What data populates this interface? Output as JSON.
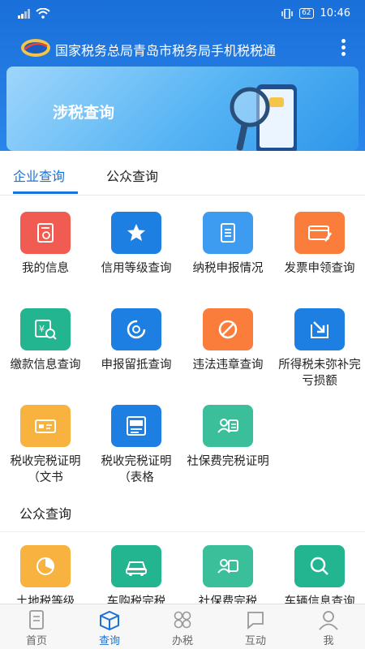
{
  "status_bar": {
    "time": "10:46",
    "battery": "62"
  },
  "app": {
    "title": "国家税务总局青岛市税务局手机税税通"
  },
  "banner": {
    "title": "涉税查询"
  },
  "tabs": [
    {
      "label": "企业查询",
      "active": true
    },
    {
      "label": "公众查询",
      "active": false
    }
  ],
  "enterprise_items": [
    {
      "label": "我的信息",
      "icon": "info-doc-icon",
      "color": "#f05b52"
    },
    {
      "label": "信用等级查询",
      "icon": "star-icon",
      "color": "#1e7fe3"
    },
    {
      "label": "纳税申报情况",
      "icon": "list-doc-icon",
      "color": "#3d9cf0"
    },
    {
      "label": "发票申领查询",
      "icon": "invoice-card-icon",
      "color": "#fa7d3c"
    },
    {
      "label": "缴款信息查询",
      "icon": "yen-search-icon",
      "color": "#22b58f"
    },
    {
      "label": "申报留抵查询",
      "icon": "refresh-circle-icon",
      "color": "#1e7fe3"
    },
    {
      "label": "违法违章查询",
      "icon": "prohibited-icon",
      "color": "#fa7d3c"
    },
    {
      "label": "所得税未弥补完亏损额",
      "icon": "arrow-down-right-icon",
      "color": "#1e7fe3"
    },
    {
      "label": "税收完税证明（文书",
      "icon": "certificate-card-icon",
      "color": "#f7b23f"
    },
    {
      "label": "税收完税证明（表格",
      "icon": "tax-paid-doc-icon",
      "color": "#1e7fe3"
    },
    {
      "label": "社保费完税证明",
      "icon": "social-insurance-icon",
      "color": "#3bbf9b"
    }
  ],
  "public_section": {
    "title": "公众查询"
  },
  "public_items": [
    {
      "label": "土地税等级",
      "icon": "pie-chart-icon",
      "color": "#f7b23f"
    },
    {
      "label": "车购税完税",
      "icon": "car-icon",
      "color": "#22b58f"
    },
    {
      "label": "社保费完税",
      "icon": "social-insurance-icon",
      "color": "#3bbf9b"
    },
    {
      "label": "车辆信息查询",
      "icon": "search-icon",
      "color": "#22b58f"
    }
  ],
  "bottom_nav": [
    {
      "label": "首页",
      "icon": "home-doc-icon",
      "active": false
    },
    {
      "label": "查询",
      "icon": "box-icon",
      "active": true
    },
    {
      "label": "办税",
      "icon": "grid-icon",
      "active": false
    },
    {
      "label": "互动",
      "icon": "chat-icon",
      "active": false
    },
    {
      "label": "我",
      "icon": "user-icon",
      "active": false
    }
  ]
}
